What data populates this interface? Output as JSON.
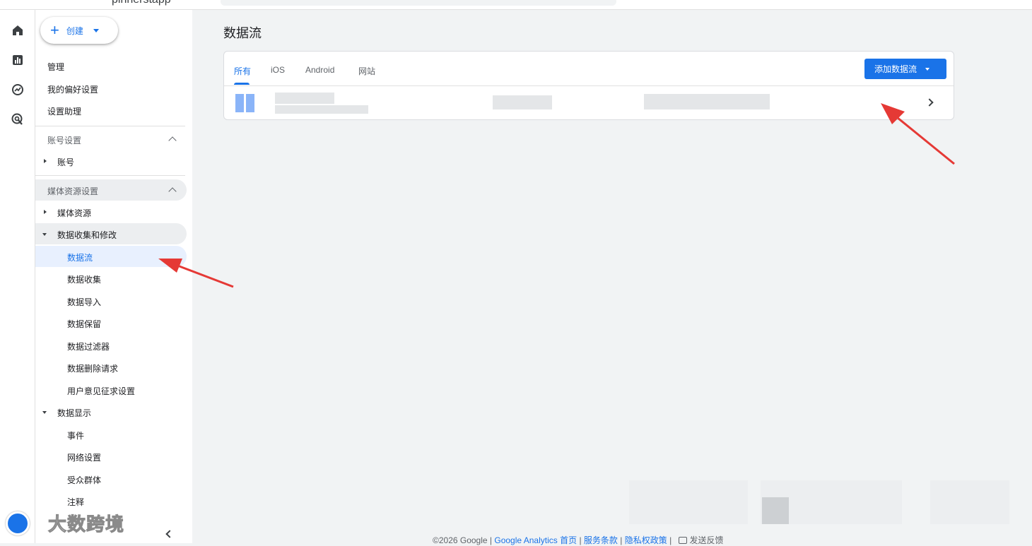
{
  "header": {
    "property_name": "pinnerstapp"
  },
  "rail": {
    "icons": [
      "home-icon",
      "reports-icon",
      "explore-icon",
      "advertising-icon"
    ]
  },
  "sidebar": {
    "create_label": "创建",
    "top_items": [
      "管理",
      "我的偏好设置",
      "设置助理"
    ],
    "account_section": {
      "header": "账号设置",
      "item": "账号"
    },
    "property_section": {
      "header": "媒体资源设置",
      "property_item": "媒体资源",
      "data_collection": {
        "label": "数据收集和修改",
        "children": [
          "数据流",
          "数据收集",
          "数据导入",
          "数据保留",
          "数据过滤器",
          "数据删除请求",
          "用户意见征求设置"
        ]
      },
      "data_display": {
        "label": "数据显示",
        "children": [
          "事件",
          "网络设置",
          "受众群体",
          "注释"
        ]
      }
    },
    "selected_item": "数据流"
  },
  "main": {
    "title": "数据流",
    "tabs": [
      {
        "label": "所有",
        "active": true
      },
      {
        "label": "iOS",
        "active": false
      },
      {
        "label": "Android",
        "active": false
      },
      {
        "label": "网站",
        "active": false
      }
    ],
    "add_button_label": "添加数据流"
  },
  "footer": {
    "copyright": "©2026 Google",
    "sep": " | ",
    "links": [
      "Google Analytics 首页",
      "服务条款",
      "隐私权政策"
    ],
    "feedback": "发送反馈"
  },
  "watermark": {
    "text": "大数跨境"
  },
  "colors": {
    "accent": "#1a73e8",
    "selected_bg": "#e8f0fe",
    "annotation": "#e53935"
  }
}
